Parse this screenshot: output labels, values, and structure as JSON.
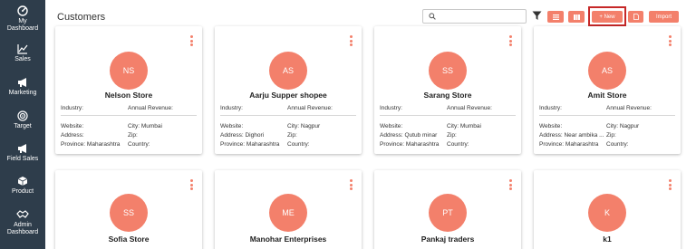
{
  "sidebar": {
    "items": [
      {
        "label": "My Dashboard",
        "icon": "dashboard-icon"
      },
      {
        "label": "Sales",
        "icon": "sales-chart-icon"
      },
      {
        "label": "Marketing",
        "icon": "megaphone-icon"
      },
      {
        "label": "Target",
        "icon": "target-icon"
      },
      {
        "label": "Field Sales",
        "icon": "megaphone-icon"
      },
      {
        "label": "Product",
        "icon": "box-icon"
      },
      {
        "label": "Admin Dashboard",
        "icon": "handshake-icon"
      }
    ]
  },
  "header": {
    "title": "Customers",
    "search": {
      "value": "",
      "placeholder": ""
    },
    "buttons": {
      "new_label": "+ New",
      "import_label": "Import"
    }
  },
  "labels": {
    "industry": "Industry:",
    "annual_revenue": "Annual Revenue:",
    "website": "Website:",
    "address": "Address:",
    "province": "Province:",
    "city": "City:",
    "zip": "Zip:",
    "country": "Country:"
  },
  "customers": [
    {
      "initials": "NS",
      "name": "Nelson Store",
      "industry": "",
      "annual_revenue": "",
      "website": "",
      "city": "Mumbai",
      "address": "",
      "zip": "",
      "province": "Maharashtra",
      "country": ""
    },
    {
      "initials": "AS",
      "name": "Aarju Supper shopee",
      "industry": "",
      "annual_revenue": "",
      "website": "",
      "city": "Nagpur",
      "address": "Dighori",
      "zip": "",
      "province": "Maharashtra",
      "country": ""
    },
    {
      "initials": "SS",
      "name": "Sarang Store",
      "industry": "",
      "annual_revenue": "",
      "website": "",
      "city": "Mumbai",
      "address": "Qutub minar",
      "zip": "",
      "province": "Maharashtra",
      "country": ""
    },
    {
      "initials": "AS",
      "name": "Amit Store",
      "industry": "",
      "annual_revenue": "",
      "website": "",
      "city": "Nagpur",
      "address": "Near ambika ...",
      "zip": "",
      "province": "Maharashtra",
      "country": ""
    },
    {
      "initials": "SS",
      "name": "Sofia Store"
    },
    {
      "initials": "ME",
      "name": "Manohar Enterprises"
    },
    {
      "initials": "PT",
      "name": "Pankaj traders"
    },
    {
      "initials": "K",
      "name": "k1"
    }
  ],
  "colors": {
    "accent": "#f3806b",
    "sidebar": "#2e3d4b",
    "highlight": "#c62828"
  }
}
